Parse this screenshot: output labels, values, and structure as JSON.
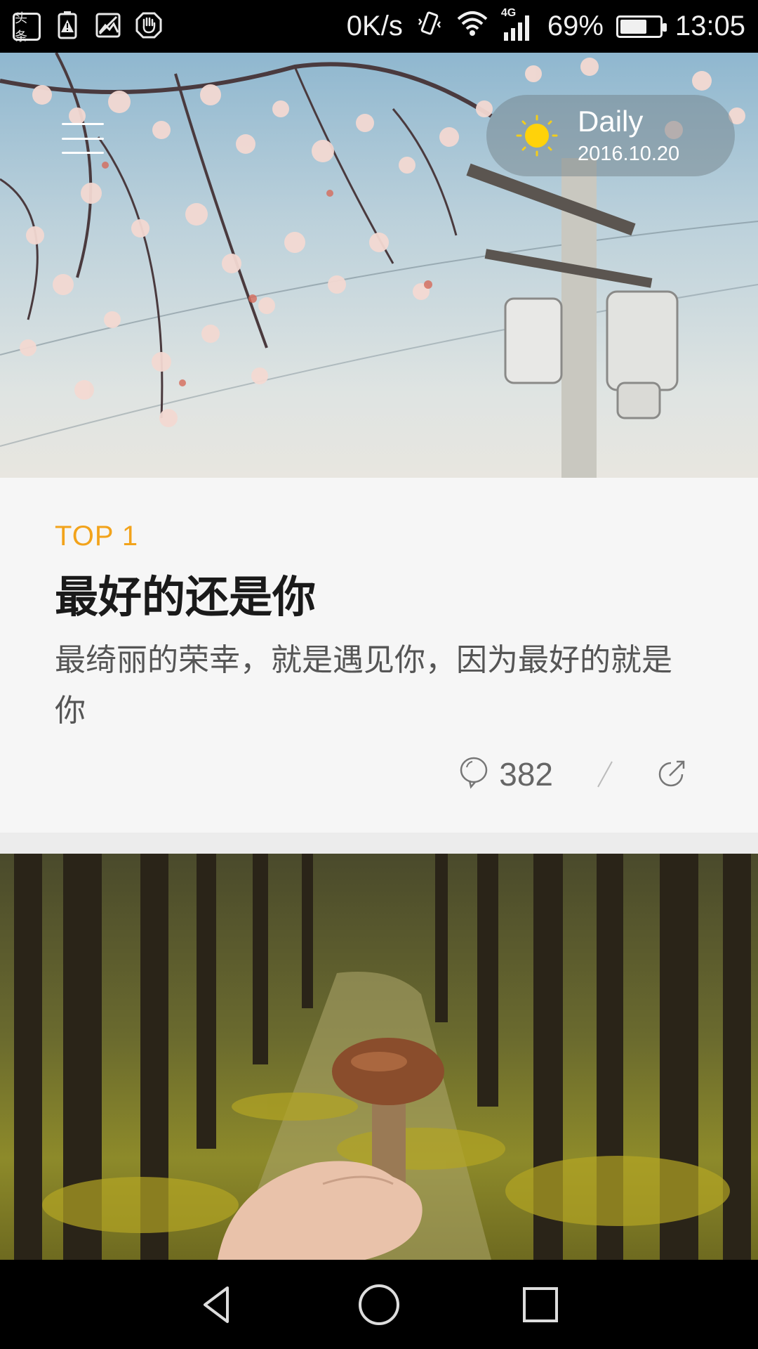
{
  "status_bar": {
    "left_icons": [
      "toutiao-icon",
      "battery-alert-icon",
      "image-icon",
      "hand-icon"
    ],
    "toutiao_label": "头条",
    "network_speed": "0K/s",
    "network_type": "4G",
    "battery_percent": "69%",
    "battery_level": 0.69,
    "time": "13:05"
  },
  "header": {
    "menu_icon": "menu-icon",
    "weather_icon": "sun-icon",
    "daily_title": "Daily",
    "daily_date": "2016.10.20"
  },
  "card": {
    "rank": "TOP 1",
    "title": "最好的还是你",
    "description": "最绮丽的荣幸，就是遇见你，因为最好的就是你",
    "comment_icon": "comment-bubble-icon",
    "comment_count": "382",
    "share_icon": "share-icon"
  },
  "colors": {
    "accent": "#f2a31b",
    "title": "#1a1a1a",
    "description": "#555555",
    "card_background": "#f6f6f6"
  },
  "nav_bar": {
    "buttons": [
      "back-icon",
      "home-icon",
      "recents-icon"
    ]
  }
}
